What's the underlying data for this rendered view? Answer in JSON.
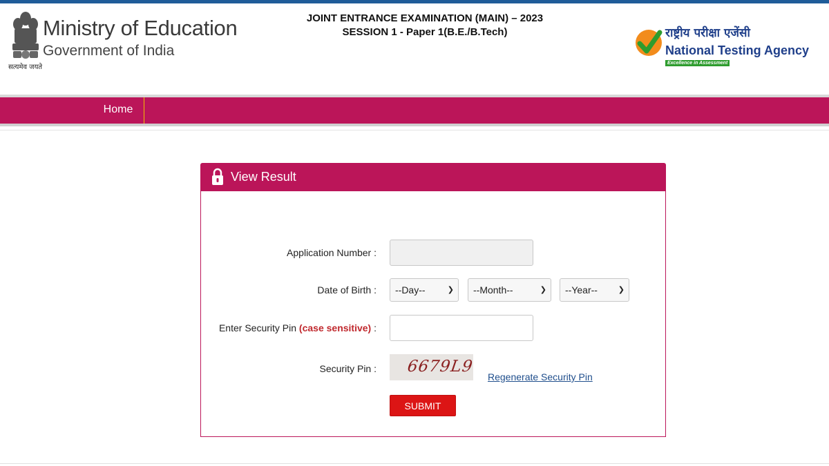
{
  "header": {
    "emblem_caption": "सत्यमेव जयते",
    "ministry_title": "Ministry of Education",
    "ministry_subtitle": "Government of India",
    "exam_title_line1": "JOINT ENTRANCE EXAMINATION (MAIN) – 2023",
    "exam_title_line2": "SESSION 1 - Paper 1(B.E./B.Tech)",
    "nta_hindi": "राष्ट्रीय परीक्षा एजेंसी",
    "nta_name": "National Testing Agency",
    "nta_tagline": "Excellence in Assessment"
  },
  "nav": {
    "home_label": "Home"
  },
  "form": {
    "title": "View Result",
    "application_number_label": "Application Number :",
    "application_number_value": "",
    "dob_label": "Date of Birth :",
    "day_selected": "--Day--",
    "month_selected": "--Month--",
    "year_selected": "--Year--",
    "security_pin_label_prefix": "Enter Security Pin",
    "security_pin_label_sensitive": "(case sensitive)",
    "security_pin_label_suffix": ":",
    "security_pin_value": "",
    "captcha_label": "Security Pin :",
    "captcha_text": "6679L9",
    "regenerate_link": "Regenerate Security Pin",
    "submit_label": "SUBMIT"
  },
  "colors": {
    "brand": "#bb1559",
    "submit": "#dc1515",
    "link": "#1f4e8c",
    "top_rule": "#1f5c99",
    "nta_green": "#2e9c2e"
  },
  "icons": {
    "emblem": "national-emblem-icon",
    "nta_logo": "nta-check-logo-icon",
    "lock": "lock-icon",
    "chevron": "chevron-down-icon"
  }
}
